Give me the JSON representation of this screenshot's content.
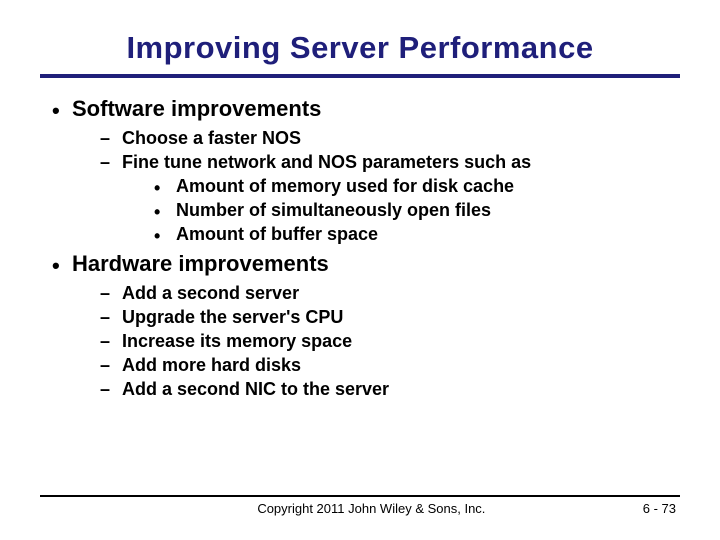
{
  "title": "Improving Server Performance",
  "sections": [
    {
      "heading": "Software improvements",
      "items": [
        {
          "text": "Choose a faster NOS",
          "sub": []
        },
        {
          "text": "Fine tune network and NOS parameters such as",
          "sub": [
            "Amount of memory used for disk cache",
            "Number of simultaneously open files",
            "Amount of buffer space"
          ]
        }
      ]
    },
    {
      "heading": "Hardware improvements",
      "items": [
        {
          "text": "Add a second server",
          "sub": []
        },
        {
          "text": "Upgrade the server's CPU",
          "sub": []
        },
        {
          "text": "Increase its memory space",
          "sub": []
        },
        {
          "text": "Add more hard disks",
          "sub": []
        },
        {
          "text": "Add a second NIC to the server",
          "sub": []
        }
      ]
    }
  ],
  "footer": {
    "copyright": "Copyright 2011 John Wiley & Sons, Inc.",
    "page": "6 - 73"
  }
}
